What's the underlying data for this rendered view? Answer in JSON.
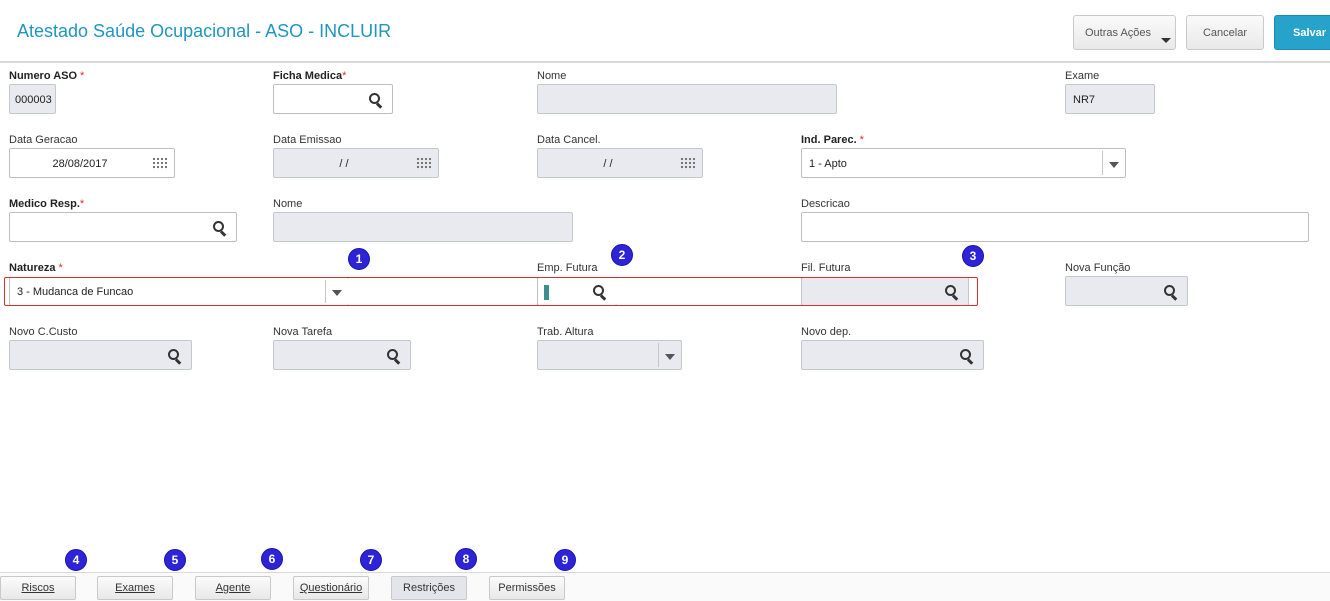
{
  "header": {
    "title": "Atestado Saúde Ocupacional - ASO - INCLUIR",
    "other_actions": "Outras Ações",
    "cancel": "Cancelar",
    "save": "Salvar"
  },
  "form": {
    "numero_aso": {
      "label": "Numero ASO",
      "required": "*",
      "value": "000003"
    },
    "ficha_medica": {
      "label": "Ficha Medica",
      "required": "*",
      "value": ""
    },
    "nome1": {
      "label": "Nome",
      "value": ""
    },
    "exame": {
      "label": "Exame",
      "value": "NR7"
    },
    "data_geracao": {
      "label": "Data Geracao",
      "value": "28/08/2017"
    },
    "data_emissao": {
      "label": "Data Emissao",
      "value": "/ /"
    },
    "data_cancel": {
      "label": "Data Cancel.",
      "value": "/ /"
    },
    "ind_parec": {
      "label": "Ind. Parec.",
      "required": "*",
      "value": "1 - Apto"
    },
    "medico_resp": {
      "label": "Medico Resp.",
      "required": "*",
      "value": ""
    },
    "nome2": {
      "label": "Nome",
      "value": ""
    },
    "descricao": {
      "label": "Descricao",
      "value": ""
    },
    "natureza": {
      "label": "Natureza",
      "required": "*",
      "value": "3 - Mudanca de Funcao"
    },
    "emp_futura": {
      "label": "Emp. Futura",
      "value": ""
    },
    "fil_futura": {
      "label": "Fil. Futura",
      "value": ""
    },
    "nova_funcao": {
      "label": "Nova Função",
      "value": ""
    },
    "novo_ccusto": {
      "label": "Novo C.Custo",
      "value": ""
    },
    "nova_tarefa": {
      "label": "Nova Tarefa",
      "value": ""
    },
    "trab_altura": {
      "label": "Trab. Altura",
      "value": ""
    },
    "novo_dep": {
      "label": "Novo dep.",
      "value": ""
    }
  },
  "badges": [
    "1",
    "2",
    "3",
    "4",
    "5",
    "6",
    "7",
    "8",
    "9"
  ],
  "tabs": [
    {
      "label": "Riscos"
    },
    {
      "label": "Exames"
    },
    {
      "label": "Agente"
    },
    {
      "label": "Questionário"
    },
    {
      "label": "Restrições"
    },
    {
      "label": "Permissões"
    }
  ],
  "colors": {
    "title": "#1f96c1",
    "save": "#26a2cb",
    "badge": "#2c24d6",
    "highlight": "#d9302b"
  },
  "icons": [
    "search-icon",
    "calendar-icon",
    "chevron-down-icon"
  ]
}
